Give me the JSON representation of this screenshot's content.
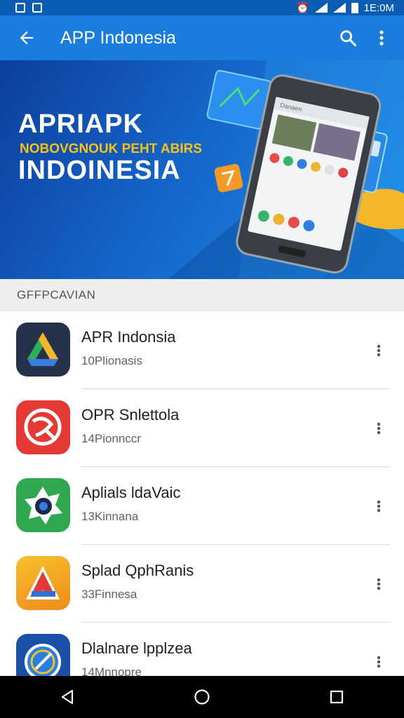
{
  "status_bar": {
    "time": "1E:0M",
    "icons": [
      "notification-icon",
      "notification-icon",
      "alarm-icon",
      "wifi-icon",
      "signal-icon",
      "battery-icon"
    ]
  },
  "app_bar": {
    "title": "APP Indonesia",
    "icons": [
      "back-arrow-icon",
      "search-icon",
      "more-vert-icon"
    ]
  },
  "banner": {
    "line1": "APRIAPK",
    "line2": "NOBOVGNOUK PEHT ABIRS",
    "line3": "INDOINESIA",
    "phone_screen_label": "Danaen"
  },
  "section": {
    "title": "GFFPCAVIAN"
  },
  "apps": [
    {
      "name": "APR Indonsia",
      "subtitle": "10Plionasis",
      "icon": "drive-triangle-icon"
    },
    {
      "name": "OPR Snlettola",
      "subtitle": "14Pionnccr",
      "icon": "red-swirl-icon"
    },
    {
      "name": "Aplials ldaVaic",
      "subtitle": "13Kinnana",
      "icon": "green-camera-icon"
    },
    {
      "name": "Splad QphRanis",
      "subtitle": "33Finnesa",
      "icon": "orange-a-icon"
    },
    {
      "name": "Dlalnare lpplzea",
      "subtitle": "14Mnnopre",
      "icon": "compass-icon"
    }
  ],
  "nav_bar": {
    "icons": [
      "nav-back-icon",
      "nav-home-icon",
      "nav-recents-icon"
    ]
  },
  "colors": {
    "app_bar": "#1a7ddd",
    "status_bar": "#0b5cb3",
    "banner_accent": "#f6c21a"
  }
}
